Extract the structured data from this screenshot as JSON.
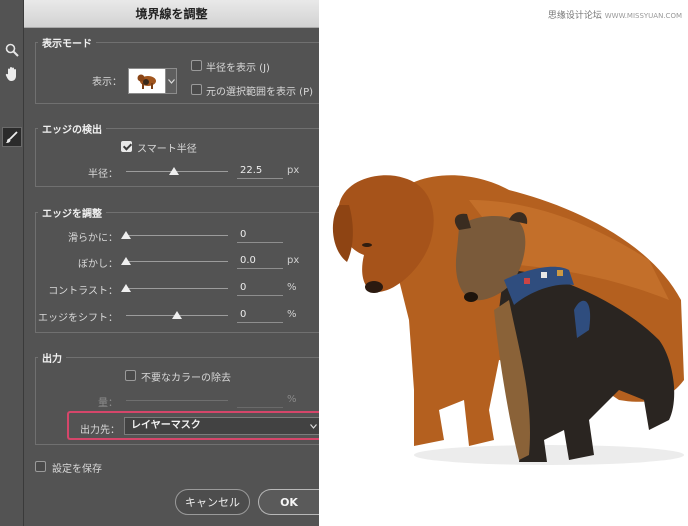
{
  "dialog": {
    "title": "境界線を調整",
    "view_mode": {
      "title": "表示モード",
      "view_label": "表示：",
      "show_radius": {
        "label": "半径を表示 (J)",
        "checked": false
      },
      "show_original": {
        "label": "元の選択範囲を表示 (P)",
        "checked": false
      }
    },
    "edge_detection": {
      "title": "エッジの検出",
      "smart_radius": {
        "label": "スマート半径",
        "checked": true
      },
      "radius": {
        "label": "半径：",
        "value": "22.5",
        "unit": "px",
        "level": 0.47
      }
    },
    "adjust_edge": {
      "title": "エッジを調整",
      "smooth": {
        "label": "滑らかに：",
        "value": "0",
        "unit": "",
        "level": 0.0
      },
      "feather": {
        "label": "ぼかし：",
        "value": "0.0",
        "unit": "px",
        "level": 0.0
      },
      "contrast": {
        "label": "コントラスト：",
        "value": "0",
        "unit": "%",
        "level": 0.0
      },
      "shift_edge": {
        "label": "エッジをシフト：",
        "value": "0",
        "unit": "%",
        "level": 0.5
      }
    },
    "output": {
      "title": "出力",
      "decontaminate": {
        "label": "不要なカラーの除去",
        "checked": false
      },
      "amount": {
        "label": "量：",
        "value": "",
        "unit": "%"
      },
      "output_to_label": "出力先：",
      "output_to_value": "レイヤーマスク"
    },
    "remember_settings": {
      "label": "設定を保存",
      "checked": false
    },
    "cancel_label": "キャンセル",
    "ok_label": "OK"
  },
  "tools": [
    "zoom-icon",
    "hand-icon",
    "refine-brush-icon"
  ],
  "watermark": {
    "text": "思缘设计论坛",
    "url": "WWW.MISSYUAN.COM"
  },
  "colors": {
    "highlight": "#d5466a",
    "panel": "#535353"
  }
}
